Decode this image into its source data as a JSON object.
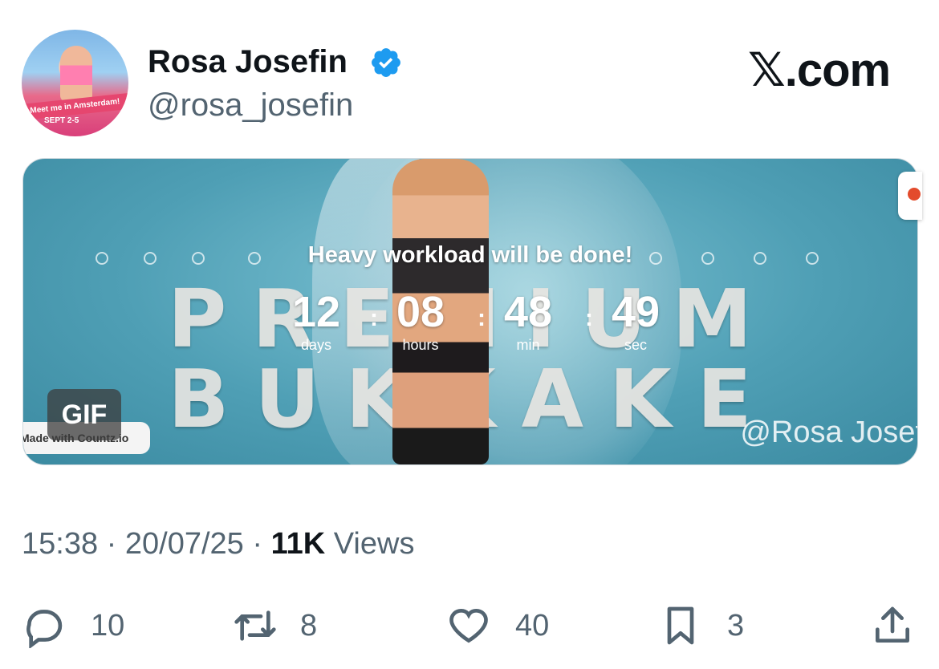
{
  "author": {
    "name": "Rosa Josefin",
    "handle": "@rosa_josefin",
    "avatar_text_1": "Meet me in Amsterdam!",
    "avatar_text_2": "SEPT 2-5",
    "verified_icon": "verified-badge-icon"
  },
  "brand": "𝕏.com",
  "media": {
    "headline": "Heavy workload will be done!",
    "background_text": "PREMIUM BUKKAKE",
    "countdown": [
      {
        "value": "12",
        "label": "days"
      },
      {
        "value": "08",
        "label": "hours"
      },
      {
        "value": "48",
        "label": "min"
      },
      {
        "value": "49",
        "label": "sec"
      }
    ],
    "separator": ":",
    "gif_label": "GIF",
    "countz_label": "Made with Countz.io",
    "watermark": "@Rosa Josef"
  },
  "meta": {
    "time": "15:38",
    "date": "20/07/25",
    "dot": "·",
    "views_count": "11K",
    "views_label": "Views"
  },
  "actions": {
    "replies": "10",
    "reposts": "8",
    "likes": "40",
    "bookmarks": "3"
  },
  "colors": {
    "verified_blue": "#1d9bf0",
    "secondary_text": "#536471",
    "primary_text": "#0f1419"
  }
}
